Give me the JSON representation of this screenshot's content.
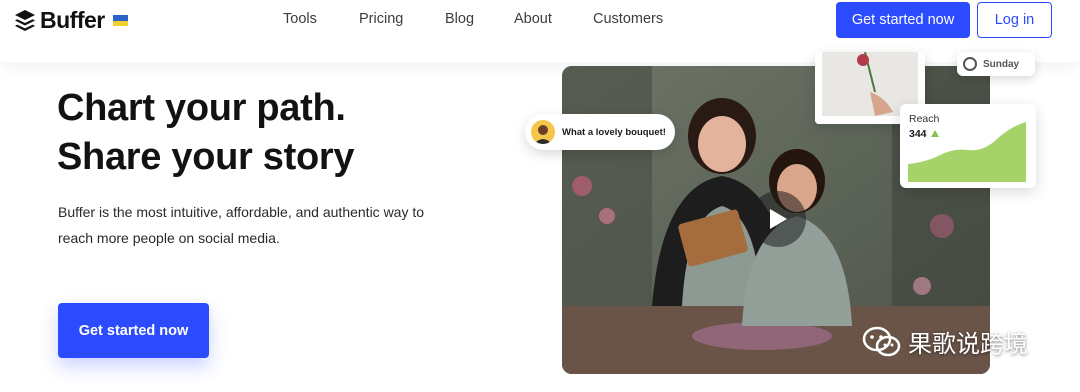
{
  "brand": {
    "name": "Buffer",
    "accent": "#2c4bff"
  },
  "nav": {
    "items": [
      "Tools",
      "Pricing",
      "Blog",
      "About",
      "Customers"
    ]
  },
  "header": {
    "cta_label": "Get started now",
    "login_label": "Log in"
  },
  "hero": {
    "headline_line1": "Chart your path.",
    "headline_line2": "Share your story",
    "subtext": "Buffer is the most intuitive, affordable, and authentic way to reach more people on social media.",
    "cta_label": "Get started now"
  },
  "media": {
    "comment": "What a lovely bouquet!",
    "day_label": "Sunday",
    "reach_label": "Reach",
    "reach_value": "344",
    "reach_trend": "up"
  },
  "watermark": {
    "text": "果歌说跨境"
  }
}
